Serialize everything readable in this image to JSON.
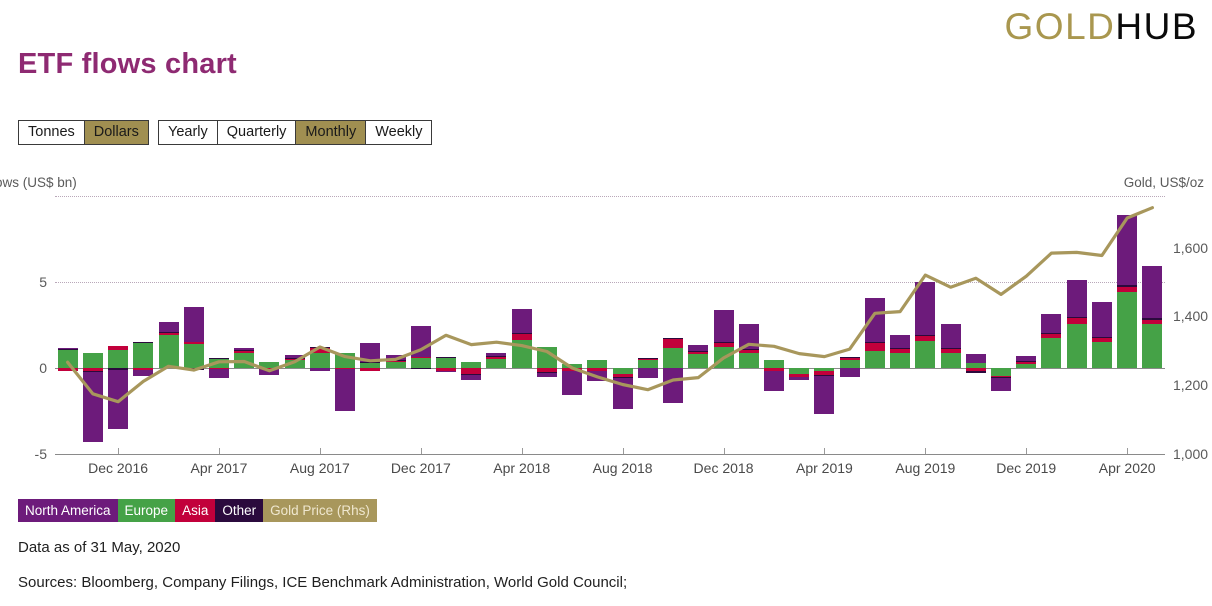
{
  "logo": {
    "first": "GOLD",
    "second": "HUB"
  },
  "title": "ETF flows chart",
  "controls": {
    "units": [
      {
        "label": "Tonnes",
        "active": false
      },
      {
        "label": "Dollars",
        "active": true
      }
    ],
    "period": [
      {
        "label": "Yearly",
        "active": false
      },
      {
        "label": "Quarterly",
        "active": false
      },
      {
        "label": "Monthly",
        "active": true
      },
      {
        "label": "Weekly",
        "active": false
      }
    ]
  },
  "legend": [
    {
      "label": "North America",
      "color": "#6d1b7b"
    },
    {
      "label": "Europe",
      "color": "#45a247"
    },
    {
      "label": "Asia",
      "color": "#c2003b"
    },
    {
      "label": "Other",
      "color": "#2b0a3d"
    },
    {
      "label": "Gold Price (Rhs)",
      "color": "#a8975c"
    }
  ],
  "footer": {
    "data_as_of": "Data as of 31 May, 2020",
    "sources": "Sources: Bloomberg, Company Filings, ICE Benchmark Administration, World Gold Council;"
  },
  "chart_data": {
    "type": "bar",
    "title": "ETF flows chart",
    "subtype": "stacked-bar-with-line",
    "ylabel": "Flows (US$ bn)",
    "ylabel_displayed": "lows (US$ bn)",
    "ylabel_right": "Gold, US$/oz",
    "xlabel": "",
    "grid": true,
    "legend_position": "below",
    "ylim": [
      -5,
      10
    ],
    "yticks": [
      -5,
      0,
      5
    ],
    "ytick_labels": [
      "-5",
      "0",
      "5"
    ],
    "ylim_right": [
      1000,
      1750
    ],
    "yticks_right": [
      1000,
      1200,
      1400,
      1600
    ],
    "ytick_labels_right": [
      "1,000",
      "1,200",
      "1,400",
      "1,600"
    ],
    "x_tick_labels": [
      "Dec 2016",
      "Apr 2017",
      "Aug 2017",
      "Dec 2017",
      "Apr 2018",
      "Aug 2018",
      "Dec 2018",
      "Apr 2019",
      "Aug 2019",
      "Dec 2019",
      "Apr 2020"
    ],
    "x_tick_indices": [
      2,
      6,
      10,
      14,
      18,
      22,
      26,
      30,
      34,
      38,
      42
    ],
    "categories": [
      "Oct 2016",
      "Nov 2016",
      "Dec 2016",
      "Jan 2017",
      "Feb 2017",
      "Mar 2017",
      "Apr 2017",
      "May 2017",
      "Jun 2017",
      "Jul 2017",
      "Aug 2017",
      "Sep 2017",
      "Oct 2017",
      "Nov 2017",
      "Dec 2017",
      "Jan 2018",
      "Feb 2018",
      "Mar 2018",
      "Apr 2018",
      "May 2018",
      "Jun 2018",
      "Jul 2018",
      "Aug 2018",
      "Sep 2018",
      "Oct 2018",
      "Nov 2018",
      "Dec 2018",
      "Jan 2019",
      "Feb 2019",
      "Mar 2019",
      "Apr 2019",
      "May 2019",
      "Jun 2019",
      "Jul 2019",
      "Aug 2019",
      "Sep 2019",
      "Oct 2019",
      "Nov 2019",
      "Dec 2019",
      "Jan 2020",
      "Feb 2020",
      "Mar 2020",
      "Apr 2020",
      "May 2020"
    ],
    "series": [
      {
        "name": "North America",
        "color": "#6d1b7b",
        "values": [
          0.05,
          -4.05,
          -3.45,
          -0.35,
          0.55,
          2.05,
          -0.55,
          0.1,
          -0.3,
          0.15,
          -0.2,
          -2.4,
          1.1,
          0.25,
          1.8,
          -0.1,
          -0.3,
          0.2,
          1.4,
          -0.25,
          -1.35,
          -0.55,
          -1.75,
          -0.6,
          -2.05,
          0.35,
          1.85,
          1.45,
          -1.15,
          -0.15,
          -2.25,
          -0.5,
          2.55,
          0.75,
          3.05,
          1.4,
          0.5,
          -0.75,
          0.3,
          1.1,
          2.15,
          2.0,
          4.1,
          3.05
        ]
      },
      {
        "name": "Europe",
        "color": "#45a247",
        "values": [
          1.1,
          0.9,
          1.05,
          1.45,
          1.9,
          1.4,
          0.55,
          0.9,
          0.35,
          0.45,
          0.85,
          0.85,
          0.3,
          0.35,
          0.6,
          0.6,
          0.35,
          0.55,
          1.6,
          1.25,
          0.25,
          0.45,
          -0.35,
          0.45,
          1.15,
          0.8,
          1.2,
          0.85,
          0.45,
          -0.35,
          -0.2,
          0.45,
          1.0,
          0.9,
          1.55,
          0.9,
          0.3,
          -0.45,
          0.25,
          1.75,
          2.55,
          1.5,
          4.4,
          2.55
        ]
      },
      {
        "name": "Asia",
        "color": "#c2003b",
        "values": [
          -0.2,
          -0.15,
          0.25,
          -0.1,
          0.15,
          0.1,
          -0.05,
          0.1,
          -0.05,
          0.1,
          0.35,
          -0.05,
          -0.15,
          0.1,
          0.05,
          -0.15,
          -0.35,
          0.1,
          0.4,
          -0.25,
          -0.15,
          -0.15,
          -0.2,
          0.1,
          0.55,
          0.15,
          0.25,
          0.2,
          -0.15,
          -0.15,
          -0.2,
          0.15,
          0.45,
          0.2,
          0.3,
          0.2,
          -0.2,
          -0.1,
          0.1,
          0.2,
          0.35,
          0.25,
          0.3,
          0.25
        ]
      },
      {
        "name": "Other",
        "color": "#2b0a3d",
        "values": [
          0.02,
          -0.08,
          -0.12,
          0.05,
          0.06,
          -0.1,
          0.03,
          0.04,
          -0.03,
          0.04,
          0.05,
          -0.03,
          0.05,
          0.04,
          -0.05,
          0.03,
          -0.04,
          0.04,
          0.05,
          -0.04,
          -0.05,
          -0.04,
          -0.06,
          0.04,
          0.07,
          0.05,
          0.06,
          0.05,
          -0.04,
          -0.04,
          -0.05,
          0.05,
          0.07,
          0.05,
          0.08,
          0.05,
          -0.04,
          -0.05,
          0.05,
          0.07,
          0.09,
          0.08,
          0.1,
          0.09
        ]
      }
    ],
    "line_series": {
      "name": "Gold Price (Rhs)",
      "color": "#a8975c",
      "axis": "right",
      "values": [
        1267,
        1175,
        1152,
        1211,
        1255,
        1244,
        1268,
        1269,
        1242,
        1268,
        1311,
        1283,
        1271,
        1275,
        1303,
        1345,
        1318,
        1325,
        1315,
        1298,
        1250,
        1224,
        1202,
        1187,
        1215,
        1222,
        1279,
        1319,
        1313,
        1292,
        1283,
        1305,
        1409,
        1414,
        1520,
        1485,
        1511,
        1464,
        1517,
        1584,
        1586,
        1577,
        1686,
        1716
      ]
    },
    "notes": "43 monthly bars, Oct 2016 through May 2020; stacked positive above zero and negative below zero; gold price line on right axis"
  }
}
